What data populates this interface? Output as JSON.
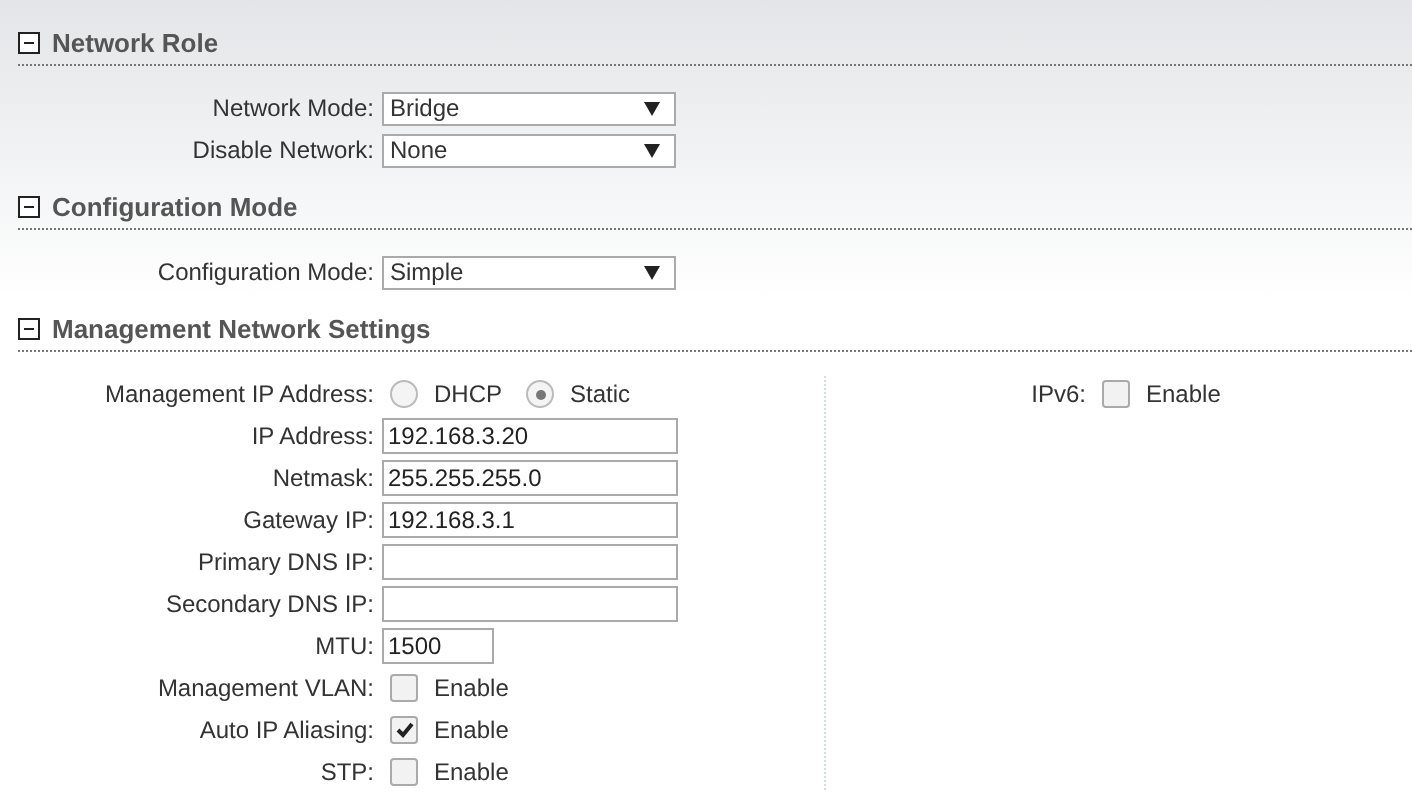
{
  "sections": [
    {
      "title": "Network Role",
      "expanded": true,
      "left": [
        {
          "kind": "select",
          "label": "Network Mode:",
          "value": "Bridge"
        },
        {
          "kind": "select",
          "label": "Disable Network:",
          "value": "None"
        }
      ]
    },
    {
      "title": "Configuration Mode",
      "expanded": true,
      "left": [
        {
          "kind": "select",
          "label": "Configuration Mode:",
          "value": "Simple"
        }
      ]
    },
    {
      "title": "Management Network Settings",
      "expanded": true,
      "left": [
        {
          "kind": "radio",
          "label": "Management IP Address:",
          "options": [
            {
              "label": "DHCP",
              "selected": false
            },
            {
              "label": "Static",
              "selected": true
            }
          ]
        },
        {
          "kind": "text",
          "label": "IP Address:",
          "value": "192.168.3.20"
        },
        {
          "kind": "text",
          "label": "Netmask:",
          "value": "255.255.255.0"
        },
        {
          "kind": "text",
          "label": "Gateway IP:",
          "value": "192.168.3.1"
        },
        {
          "kind": "text",
          "label": "Primary DNS IP:"
        },
        {
          "kind": "text",
          "label": "Secondary DNS IP:"
        },
        {
          "kind": "short",
          "label": "MTU:",
          "value": "1500"
        },
        {
          "kind": "checkbox",
          "label": "Management VLAN:",
          "text": "Enable",
          "checked": false
        },
        {
          "kind": "checkbox",
          "label": "Auto IP Aliasing:",
          "text": "Enable",
          "checked": true
        },
        {
          "kind": "checkbox",
          "label": "STP:",
          "text": "Enable",
          "checked": false
        }
      ],
      "right": [
        {
          "kind": "checkbox",
          "label": "IPv6:",
          "text": "Enable",
          "checked": false
        }
      ]
    }
  ]
}
